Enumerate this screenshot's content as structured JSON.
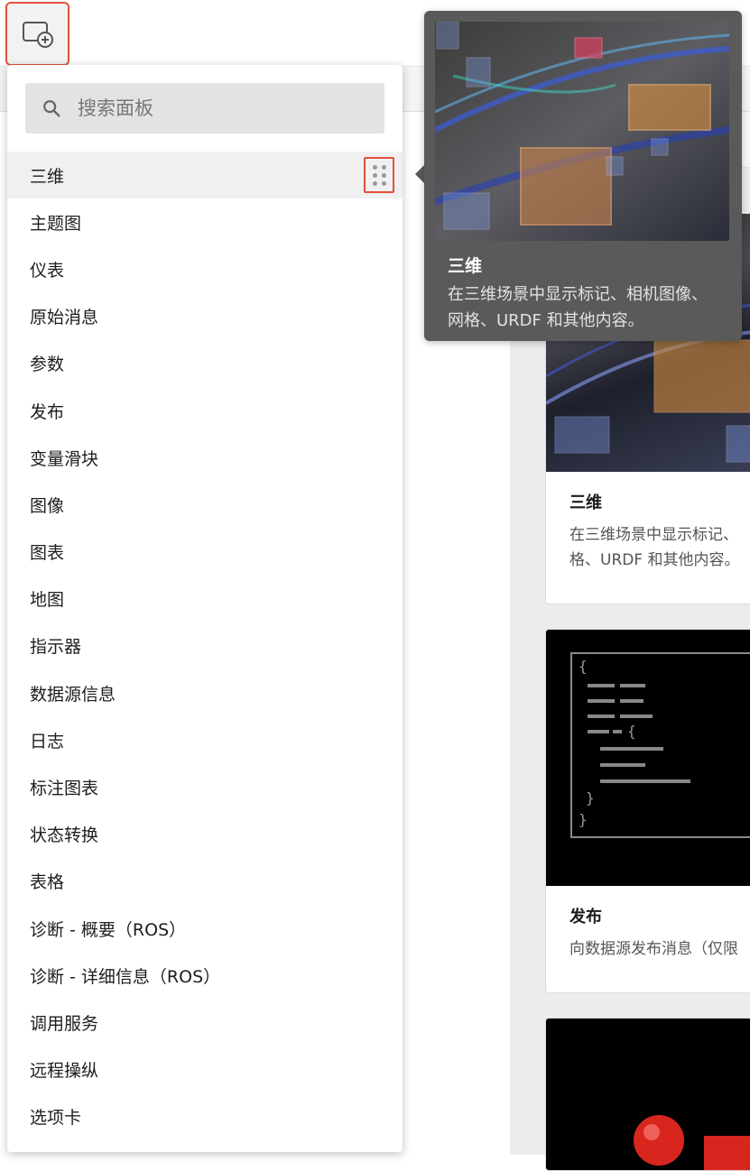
{
  "toolbar": {
    "add_panel_icon": "add-panel-icon"
  },
  "search": {
    "placeholder": "搜索面板",
    "icon": "search-icon"
  },
  "panels": [
    {
      "label": "三维"
    },
    {
      "label": "主题图"
    },
    {
      "label": "仪表"
    },
    {
      "label": "原始消息"
    },
    {
      "label": "参数"
    },
    {
      "label": "发布"
    },
    {
      "label": "变量滑块"
    },
    {
      "label": "图像"
    },
    {
      "label": "图表"
    },
    {
      "label": "地图"
    },
    {
      "label": "指示器"
    },
    {
      "label": "数据源信息"
    },
    {
      "label": "日志"
    },
    {
      "label": "标注图表"
    },
    {
      "label": "状态转换"
    },
    {
      "label": "表格"
    },
    {
      "label": "诊断 - 概要（ROS）"
    },
    {
      "label": "诊断 - 详细信息（ROS）"
    },
    {
      "label": "调用服务"
    },
    {
      "label": "远程操纵"
    },
    {
      "label": "选项卡"
    }
  ],
  "tooltip": {
    "title": "三维",
    "description": "在三维场景中显示标记、相机图像、网格、URDF 和其他内容。"
  },
  "cards": [
    {
      "title": "三维",
      "description_line1": "在三维场景中显示标记、",
      "description_line2": "格、URDF 和其他内容。"
    },
    {
      "title": "发布",
      "description_line1": "向数据源发布消息（仅限"
    }
  ],
  "colors": {
    "highlight_border": "#e34f3a",
    "tooltip_bg": "#5a5a5a"
  }
}
